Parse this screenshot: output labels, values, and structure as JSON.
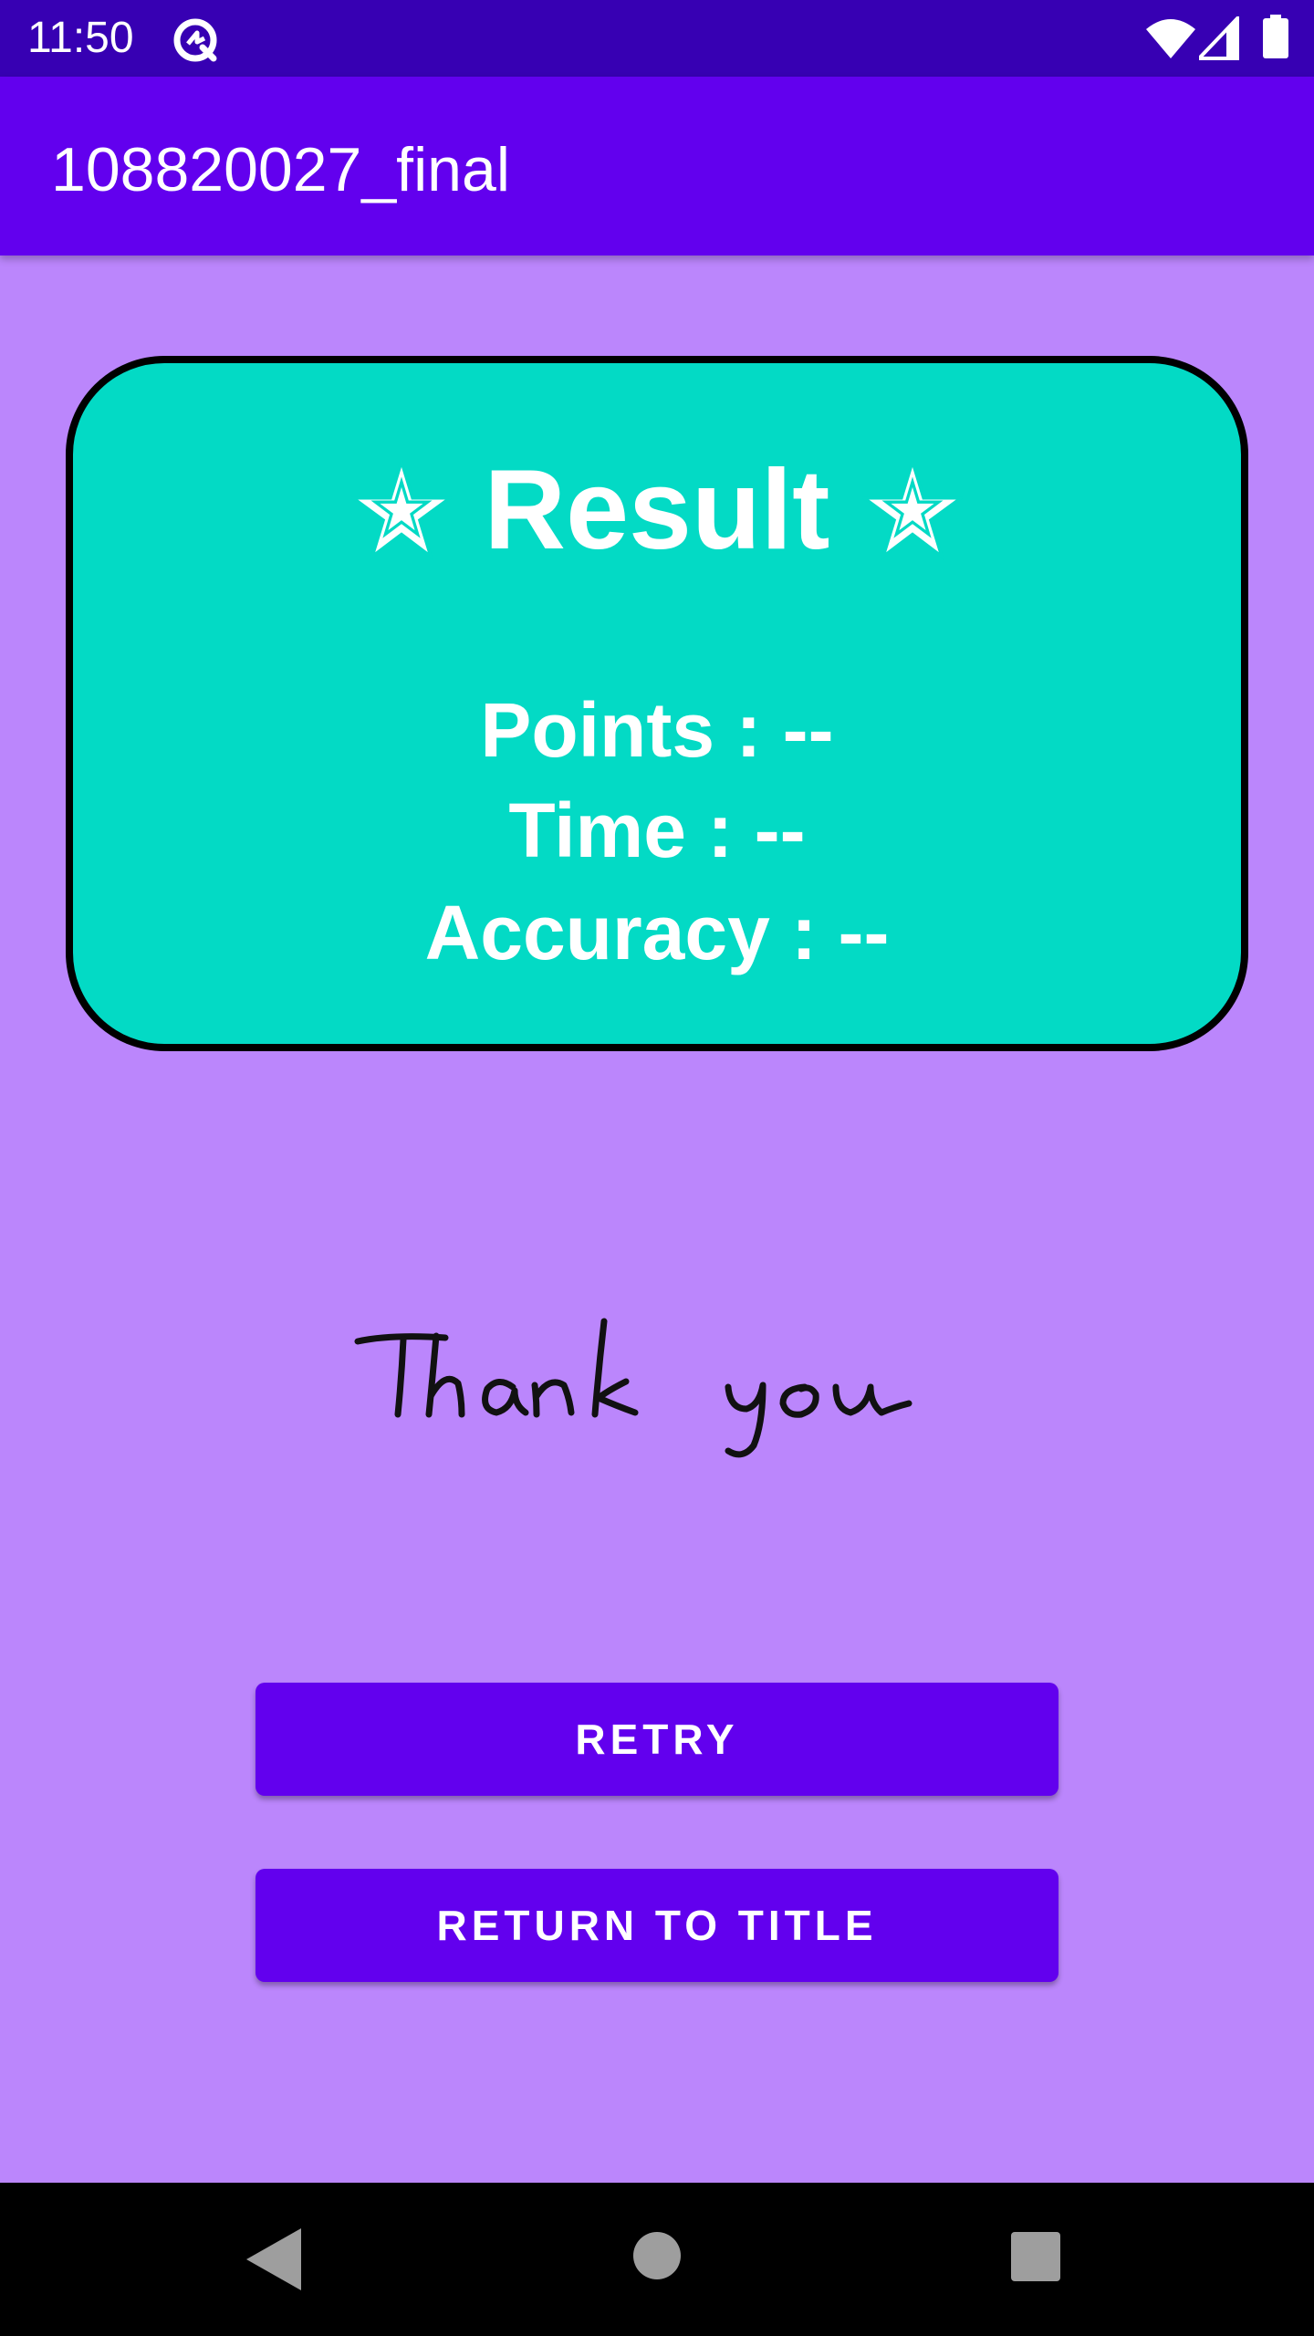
{
  "status_bar": {
    "time": "11:50",
    "icons": [
      "app-notification-icon",
      "wifi-icon",
      "signal-icon",
      "battery-icon"
    ]
  },
  "app_bar": {
    "title": "108820027_final"
  },
  "result_card": {
    "title": "Result",
    "title_icon": "star-icon",
    "points": "Points : --",
    "time": "Time : --",
    "accuracy": "Accuracy : --",
    "colors": {
      "background": "#03dac5",
      "border": "#000000"
    }
  },
  "signature": {
    "text": "Thank you"
  },
  "buttons": {
    "retry": "RETRY",
    "return_to_title": "RETURN TO TITLE"
  },
  "nav_bar": {
    "icons": [
      "back-icon",
      "home-icon",
      "recents-icon"
    ]
  },
  "colors": {
    "status_bar": "#3700b3",
    "app_bar": "#6200ee",
    "page_background": "#bb86fc",
    "button": "#6200ee"
  }
}
